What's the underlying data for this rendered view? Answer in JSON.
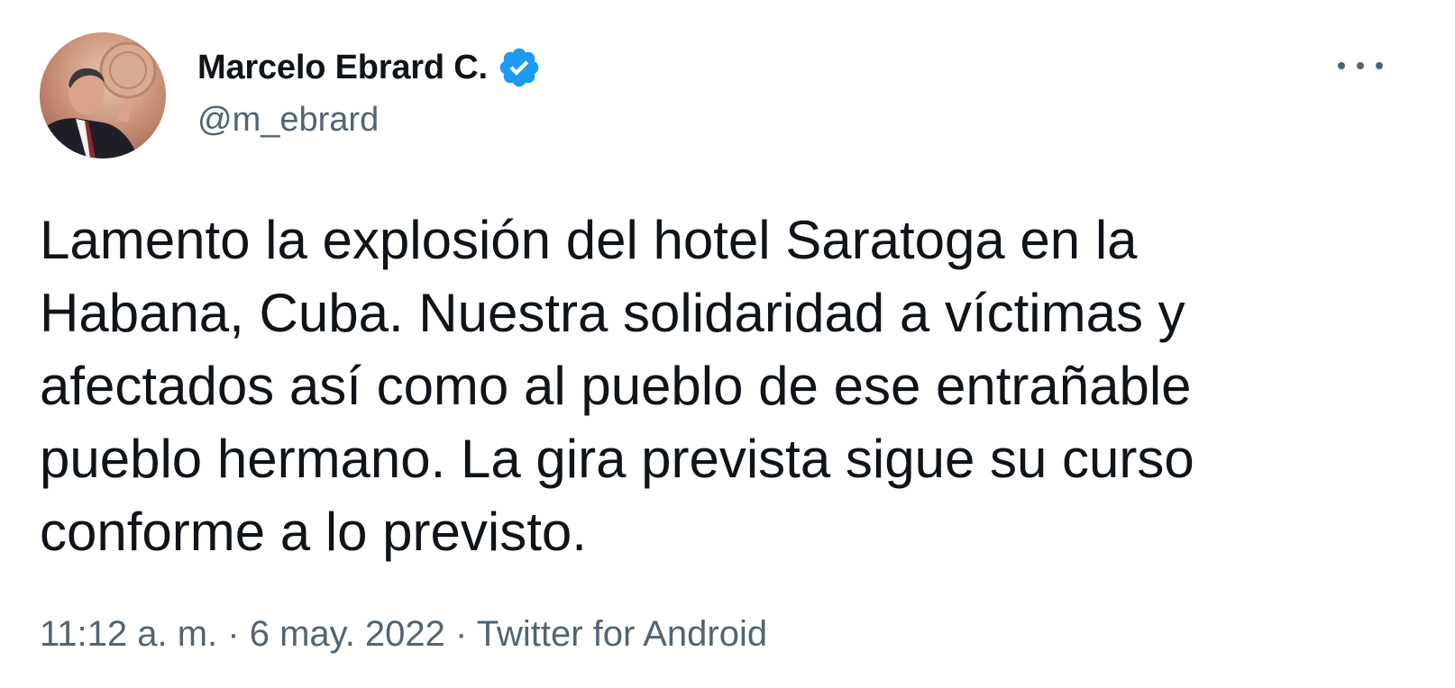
{
  "author": {
    "display_name": "Marcelo Ebrard C.",
    "handle": "@m_ebrard",
    "verified": true
  },
  "tweet": {
    "text": "Lamento la explosión del hotel Saratoga en la\nHabana, Cuba. Nuestra solidaridad a víctimas y\nafectados así como al pueblo de ese entrañable\npueblo hermano. La gira prevista sigue su curso\nconforme a lo previsto.",
    "time": "11:12 a. m.",
    "separator": "·",
    "date": "6 may. 2022",
    "source": "Twitter for Android"
  },
  "icons": {
    "verified": "verified-badge-icon",
    "more": "more-options-icon"
  },
  "colors": {
    "text_primary": "#0f1419",
    "text_secondary": "#536471",
    "verified_blue": "#1d9bf0"
  }
}
